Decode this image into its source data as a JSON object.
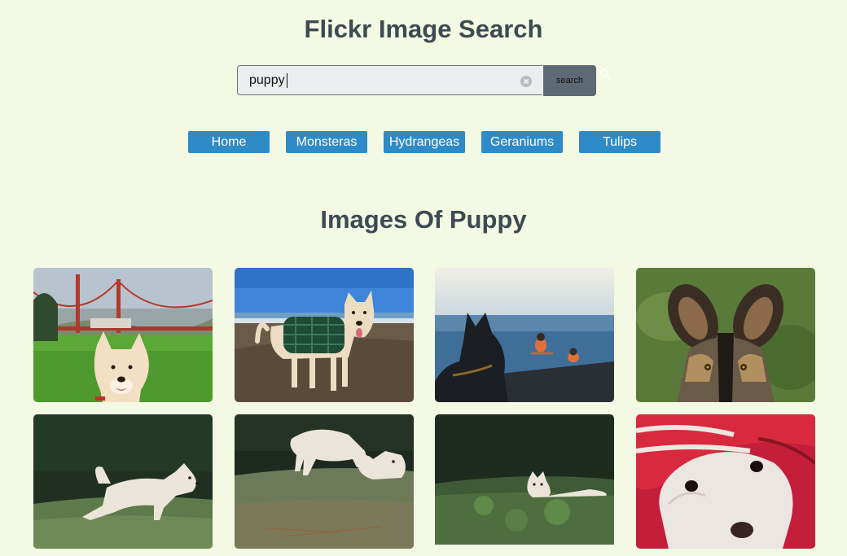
{
  "page": {
    "title": "Flickr Image Search"
  },
  "search": {
    "value": "puppy",
    "button_label": "search"
  },
  "nav": {
    "items": [
      {
        "label": "Home"
      },
      {
        "label": "Monsteras"
      },
      {
        "label": "Hydrangeas"
      },
      {
        "label": "Geraniums"
      },
      {
        "label": "Tulips"
      }
    ]
  },
  "results": {
    "heading": "Images Of Puppy",
    "photos": [
      {
        "subject": "white dog in park by golden gate bridge"
      },
      {
        "subject": "dog in plaid coat on beach"
      },
      {
        "subject": "dog silhouette watching people in water"
      },
      {
        "subject": "african wild dog face close-up"
      },
      {
        "subject": "white dog stretching on grass"
      },
      {
        "subject": "two white wolves playing in field"
      },
      {
        "subject": "white wolf lying in grass"
      },
      {
        "subject": "fluffy puppy under red blanket"
      }
    ]
  },
  "colors": {
    "background": "#f3f9e3",
    "heading": "#3d4a52",
    "nav_button": "#2e8bc8",
    "search_button": "#5c6a74"
  }
}
